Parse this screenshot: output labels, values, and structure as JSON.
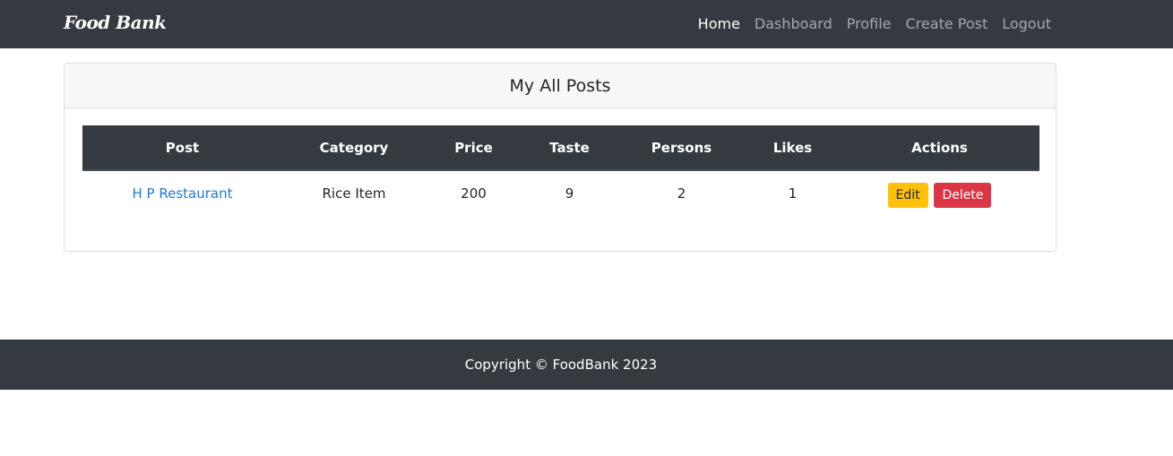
{
  "navbar": {
    "brand": "Food Bank",
    "links": [
      {
        "label": "Home",
        "active": true
      },
      {
        "label": "Dashboard",
        "active": false
      },
      {
        "label": "Profile",
        "active": false
      },
      {
        "label": "Create Post",
        "active": false
      },
      {
        "label": "Logout",
        "active": false
      }
    ]
  },
  "card": {
    "title": "My All Posts"
  },
  "table": {
    "headers": [
      "Post",
      "Category",
      "Price",
      "Taste",
      "Persons",
      "Likes",
      "Actions"
    ],
    "rows": [
      {
        "post": "H P Restaurant",
        "category": "Rice Item",
        "price": "200",
        "taste": "9",
        "persons": "2",
        "likes": "1",
        "edit_label": "Edit",
        "delete_label": "Delete"
      }
    ]
  },
  "footer": {
    "text": "Copyright © FoodBank 2023"
  },
  "colors": {
    "navbar_bg": "#343a40",
    "edit_button": "#ffc107",
    "delete_button": "#dc3545",
    "link": "#1e7ad1"
  }
}
